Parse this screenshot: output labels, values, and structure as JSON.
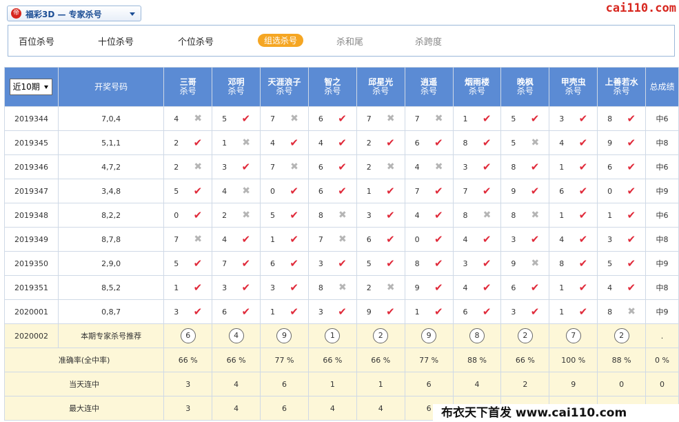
{
  "header": {
    "logo_text": "帝",
    "selector_title": "福彩3D — 专家杀号",
    "site": "cai110.com"
  },
  "tabs": [
    {
      "label": "百位杀号",
      "state": "normal"
    },
    {
      "label": "十位杀号",
      "state": "normal"
    },
    {
      "label": "个位杀号",
      "state": "normal"
    },
    {
      "label": "组选杀号",
      "state": "active"
    },
    {
      "label": "杀和尾",
      "state": "dim"
    },
    {
      "label": "杀跨度",
      "state": "dim"
    }
  ],
  "table": {
    "period_select": "近10期",
    "draw_header": "开奖号码",
    "kill_sub": "杀号",
    "total_header": "总成绩",
    "experts": [
      "三哥",
      "邓明",
      "天涯浪子",
      "智之",
      "邱星光",
      "逍遥",
      "烟雨楼",
      "晚枫",
      "甲壳虫",
      "上善若水"
    ],
    "rows": [
      {
        "period": "2019344",
        "draw": "7,0,4",
        "picks": [
          [
            4,
            0
          ],
          [
            5,
            1
          ],
          [
            7,
            0
          ],
          [
            6,
            1
          ],
          [
            7,
            0
          ],
          [
            7,
            0
          ],
          [
            1,
            1
          ],
          [
            5,
            1
          ],
          [
            3,
            1
          ],
          [
            8,
            1
          ]
        ],
        "total": "中6"
      },
      {
        "period": "2019345",
        "draw": "5,1,1",
        "picks": [
          [
            2,
            1
          ],
          [
            1,
            0
          ],
          [
            4,
            1
          ],
          [
            4,
            1
          ],
          [
            2,
            1
          ],
          [
            6,
            1
          ],
          [
            8,
            1
          ],
          [
            5,
            0
          ],
          [
            4,
            1
          ],
          [
            9,
            1
          ]
        ],
        "total": "中8"
      },
      {
        "period": "2019346",
        "draw": "4,7,2",
        "picks": [
          [
            2,
            0
          ],
          [
            3,
            1
          ],
          [
            7,
            0
          ],
          [
            6,
            1
          ],
          [
            2,
            0
          ],
          [
            4,
            0
          ],
          [
            3,
            1
          ],
          [
            8,
            1
          ],
          [
            1,
            1
          ],
          [
            6,
            1
          ]
        ],
        "total": "中6"
      },
      {
        "period": "2019347",
        "draw": "3,4,8",
        "picks": [
          [
            5,
            1
          ],
          [
            4,
            0
          ],
          [
            0,
            1
          ],
          [
            6,
            1
          ],
          [
            1,
            1
          ],
          [
            7,
            1
          ],
          [
            7,
            1
          ],
          [
            9,
            1
          ],
          [
            6,
            1
          ],
          [
            0,
            1
          ]
        ],
        "total": "中9"
      },
      {
        "period": "2019348",
        "draw": "8,2,2",
        "picks": [
          [
            0,
            1
          ],
          [
            2,
            0
          ],
          [
            5,
            1
          ],
          [
            8,
            0
          ],
          [
            3,
            1
          ],
          [
            4,
            1
          ],
          [
            8,
            0
          ],
          [
            8,
            0
          ],
          [
            1,
            1
          ],
          [
            1,
            1
          ]
        ],
        "total": "中6"
      },
      {
        "period": "2019349",
        "draw": "8,7,8",
        "picks": [
          [
            7,
            0
          ],
          [
            4,
            1
          ],
          [
            1,
            1
          ],
          [
            7,
            0
          ],
          [
            6,
            1
          ],
          [
            0,
            1
          ],
          [
            4,
            1
          ],
          [
            3,
            1
          ],
          [
            4,
            1
          ],
          [
            3,
            1
          ]
        ],
        "total": "中8"
      },
      {
        "period": "2019350",
        "draw": "2,9,0",
        "picks": [
          [
            5,
            1
          ],
          [
            7,
            1
          ],
          [
            6,
            1
          ],
          [
            3,
            1
          ],
          [
            5,
            1
          ],
          [
            8,
            1
          ],
          [
            3,
            1
          ],
          [
            9,
            0
          ],
          [
            8,
            1
          ],
          [
            5,
            1
          ]
        ],
        "total": "中9"
      },
      {
        "period": "2019351",
        "draw": "8,5,2",
        "picks": [
          [
            1,
            1
          ],
          [
            3,
            1
          ],
          [
            3,
            1
          ],
          [
            8,
            0
          ],
          [
            2,
            0
          ],
          [
            9,
            1
          ],
          [
            4,
            1
          ],
          [
            6,
            1
          ],
          [
            1,
            1
          ],
          [
            4,
            1
          ]
        ],
        "total": "中8"
      },
      {
        "period": "2020001",
        "draw": "0,8,7",
        "picks": [
          [
            3,
            1
          ],
          [
            6,
            1
          ],
          [
            1,
            1
          ],
          [
            3,
            1
          ],
          [
            9,
            1
          ],
          [
            1,
            1
          ],
          [
            6,
            1
          ],
          [
            3,
            1
          ],
          [
            1,
            1
          ],
          [
            8,
            0
          ]
        ],
        "total": "中9"
      }
    ],
    "recommend": {
      "period": "2020002",
      "label": "本期专家杀号推荐",
      "values": [
        "6",
        "4",
        "9",
        "1",
        "2",
        "9",
        "8",
        "2",
        "7",
        "2"
      ],
      "total": "."
    },
    "stats": [
      {
        "label": "准确率(全中率)",
        "values": [
          "66 %",
          "66 %",
          "77 %",
          "66 %",
          "66 %",
          "77 %",
          "88 %",
          "66 %",
          "100 %",
          "88 %"
        ],
        "total": "0 %"
      },
      {
        "label": "当天连中",
        "values": [
          "3",
          "4",
          "6",
          "1",
          "1",
          "6",
          "4",
          "2",
          "9",
          "0"
        ],
        "total": "0"
      },
      {
        "label": "最大连中",
        "values": [
          "3",
          "4",
          "6",
          "4",
          "4",
          "6",
          "",
          "",
          "",
          ""
        ],
        "total": ""
      }
    ]
  },
  "footer": {
    "text": "布衣天下首发 www.cai110.com"
  }
}
